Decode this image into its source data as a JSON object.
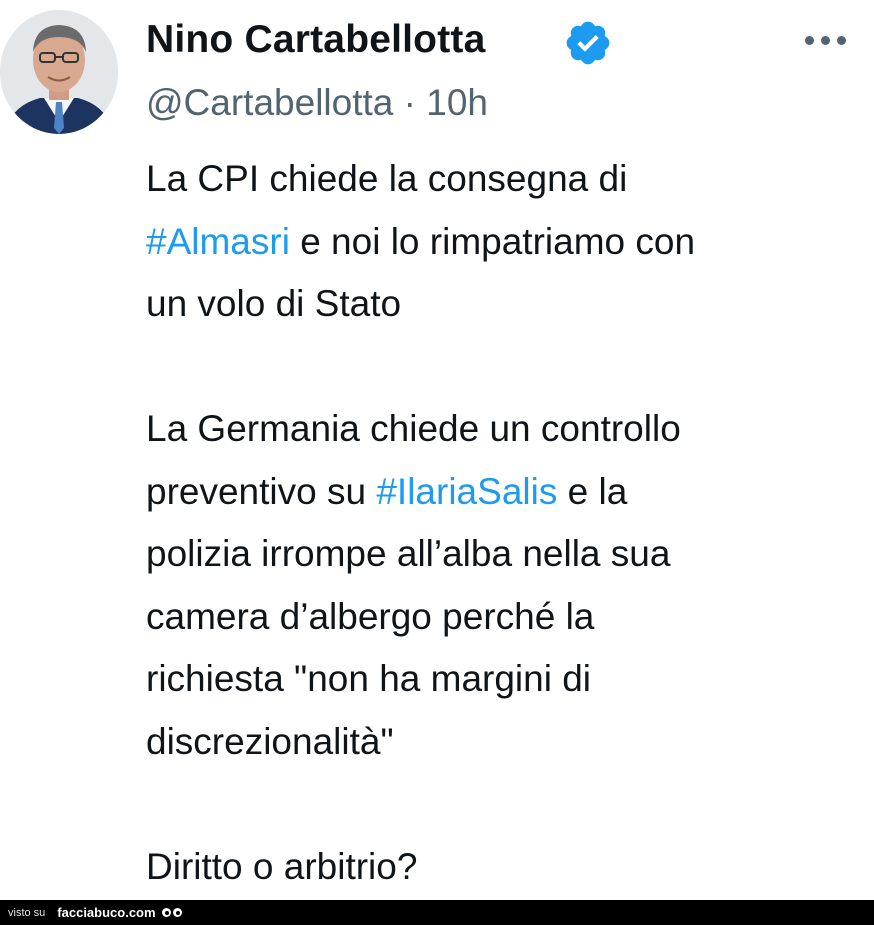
{
  "author": {
    "name": "Nino Cartabellotta",
    "handle": "@Cartabellotta",
    "separator": "·",
    "time": "10h",
    "verified": true,
    "badge_color": "#1d9bf0"
  },
  "tweet": {
    "lines": [
      {
        "parts": [
          {
            "text": "La CPI chiede la consegna di"
          }
        ]
      },
      {
        "parts": [
          {
            "text": "#Almasri",
            "hashtag": true
          },
          {
            "text": " e noi lo rimpatriamo con"
          }
        ]
      },
      {
        "parts": [
          {
            "text": "un volo di Stato"
          }
        ]
      },
      {
        "parts": []
      },
      {
        "parts": [
          {
            "text": "La Germania chiede un controllo"
          }
        ]
      },
      {
        "parts": [
          {
            "text": "preventivo su "
          },
          {
            "text": "#IlariaSalis",
            "hashtag": true
          },
          {
            "text": " e la"
          }
        ]
      },
      {
        "parts": [
          {
            "text": "polizia irrompe all’alba nella sua"
          }
        ]
      },
      {
        "parts": [
          {
            "text": "camera d’albergo perché la"
          }
        ]
      },
      {
        "parts": [
          {
            "text": "richiesta \"non ha margini di"
          }
        ]
      },
      {
        "parts": [
          {
            "text": "discrezionalità\""
          }
        ]
      },
      {
        "parts": []
      },
      {
        "parts": [
          {
            "text": "Diritto o arbitrio?"
          }
        ]
      }
    ],
    "hashtag_color": "#1d9bf0"
  },
  "watermark": {
    "prefix": "visto su",
    "brand": "facciabuco.com"
  },
  "icons": {
    "more": "more-horizontal-icon",
    "badge": "verified-badge-icon"
  }
}
